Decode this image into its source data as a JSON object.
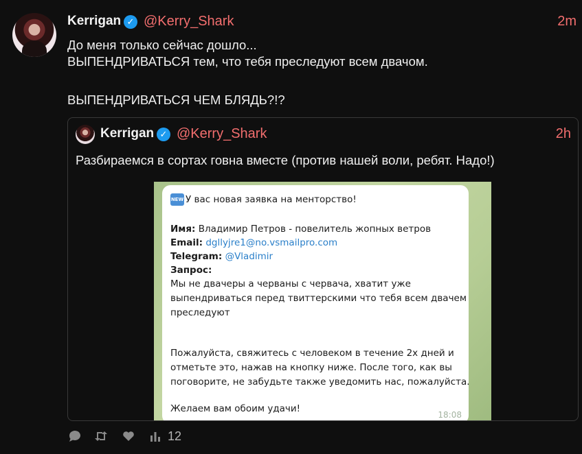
{
  "tweet": {
    "author_name": "Kerrigan",
    "handle": "@Kerry_Shark",
    "time": "2m",
    "lines": [
      "До меня только сейчас дошло...",
      "ВЫПЕНДРИВАТЬСЯ тем, что тебя преследуют всем двачом.",
      "",
      "ВЫПЕНДРИВАТЬСЯ ЧЕМ БЛЯДЬ?!?"
    ]
  },
  "quote": {
    "author_name": "Kerrigan",
    "handle": "@Kerry_Shark",
    "time": "2h",
    "text": "Разбираемся в сортах говна вместе (против нашей воли, ребят. Надо!)"
  },
  "message": {
    "badge": "NEW",
    "heading": "У вас новая заявка на менторство!",
    "name_label": "Имя:",
    "name_value": "Владимир Петров - повелитель жопных ветров",
    "email_label": "Email:",
    "email_value": "dgllyjre1@no.vsmailpro.com",
    "telegram_label": "Telegram:",
    "telegram_value": "@Vladimir",
    "request_label": "Запрос:",
    "request_lines": [
      "Мы не двачеры а черваны с червача, хватит уже",
      "выпендриваться перед твиттерскими что тебя всем двачем",
      "преследуют"
    ],
    "footer_lines": [
      "Пожалуйста, свяжитесь с человеком в течение 2х дней и",
      "отметьте это, нажав на кнопку ниже. После того, как вы",
      "поговорите, не забудьте также уведомить нас, пожалуйста."
    ],
    "wish": "Желаем вам обоим удачи!",
    "time": "18:08"
  },
  "actions": {
    "reply_icon": "reply-icon",
    "retweet_icon": "retweet-icon",
    "like_icon": "heart-icon",
    "stats_icon": "stats-icon",
    "views_count": "12"
  },
  "colors": {
    "handle": "#f26e6e",
    "verified": "#1d9bf0",
    "link": "#2a7fc9"
  }
}
